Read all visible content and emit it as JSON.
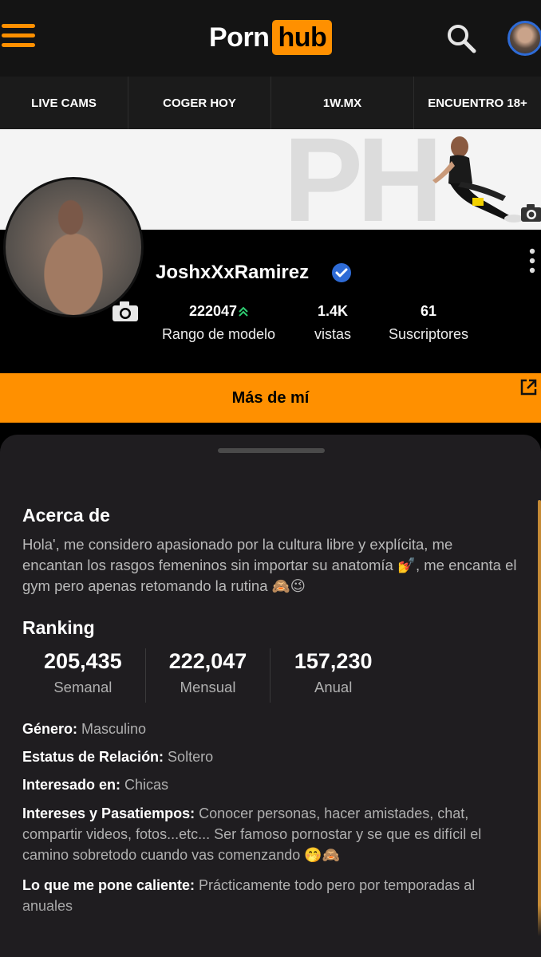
{
  "header": {
    "logo_left": "Porn",
    "logo_right": "hub"
  },
  "nav": {
    "items": [
      "LIVE CAMS",
      "COGER HOY",
      "1W.MX",
      "ENCUENTRO 18+"
    ]
  },
  "banner": {
    "watermark": "PH"
  },
  "profile": {
    "username": "JoshxXxRamirez",
    "stats": [
      {
        "value": "222047",
        "label": "Rango de modelo"
      },
      {
        "value": "1.4K",
        "label": "vistas"
      },
      {
        "value": "61",
        "label": "Suscriptores"
      }
    ]
  },
  "more_button": {
    "label": "Más de mí"
  },
  "about": {
    "title": "Acerca de",
    "text": "Hola', me considero apasionado por la cultura libre y explícita, me encantan los rasgos femeninos sin importar su anatomía 💅, me encanta el gym pero apenas retomando la rutina 🙈😉"
  },
  "ranking": {
    "title": "Ranking",
    "items": [
      {
        "value": "205,435",
        "label": "Semanal"
      },
      {
        "value": "222,047",
        "label": "Mensual"
      },
      {
        "value": "157,230",
        "label": "Anual"
      }
    ]
  },
  "info": {
    "genero_label": "Género:",
    "genero_value": " Masculino",
    "estatus_label": "Estatus de Relación:",
    "estatus_value": " Soltero",
    "interesado_label": "Interesado en:",
    "interesado_value": " Chicas",
    "intereses_label": "Intereses y Pasatiempos:",
    "intereses_value": " Conocer personas, hacer amistades, chat, compartir videos, fotos...etc... Ser famoso pornostar y se que es difícil el camino sobretodo cuando vas comenzando 🤭🙈",
    "caliente_label": "Lo que me pone caliente:",
    "caliente_value": " Prácticamente todo pero por temporadas al anuales"
  },
  "colors": {
    "brand": "#ff9000",
    "verified": "#2e6bd6",
    "rank_up": "#2ecc71"
  }
}
